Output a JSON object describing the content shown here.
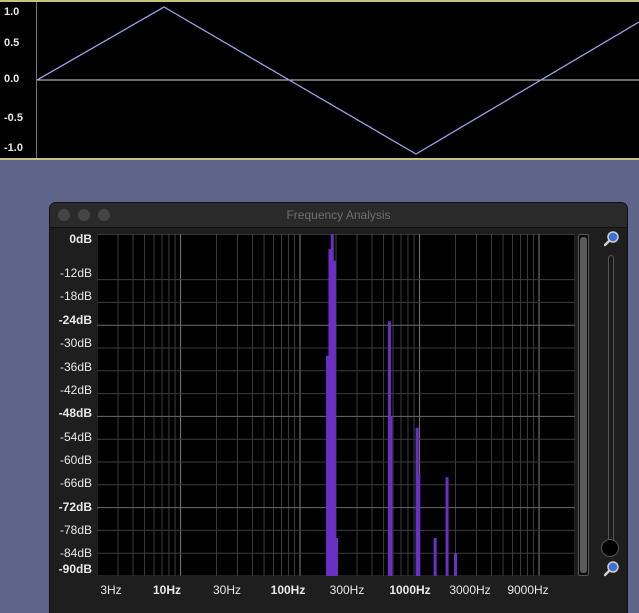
{
  "waveform": {
    "ruler_labels": [
      "1.0",
      "0.5",
      "0.0",
      "-0.5",
      "-1.0"
    ],
    "colors": {
      "line": "#9aa0e6",
      "zero_line": "#d8d8d8"
    }
  },
  "analysis_window": {
    "title": "Frequency Analysis",
    "db_labels": [
      "0dB",
      "-12dB",
      "-18dB",
      "-24dB",
      "-30dB",
      "-36dB",
      "-42dB",
      "-48dB",
      "-54dB",
      "-60dB",
      "-66dB",
      "-72dB",
      "-78dB",
      "-84dB",
      "-90dB"
    ],
    "hz_labels": [
      "3Hz",
      "10Hz",
      "30Hz",
      "100Hz",
      "300Hz",
      "1000Hz",
      "3000Hz",
      "9000Hz"
    ],
    "colors": {
      "spectrum": "#6a2fc4",
      "grid": "#3c3c3c",
      "grid_major": "#6a6a6a"
    },
    "icons": [
      "zoom-in-icon",
      "zoom-out-icon"
    ]
  },
  "chart_data": {
    "type": "bar",
    "x_scale": "log",
    "xlim_hz": [
      2,
      20000
    ],
    "ylim_db": [
      -90,
      0
    ],
    "ylabel_ticks": [
      0,
      -12,
      -18,
      -24,
      -30,
      -36,
      -42,
      -48,
      -54,
      -60,
      -66,
      -72,
      -78,
      -84,
      -90
    ],
    "xtick_labels_hz": [
      3,
      10,
      30,
      100,
      300,
      1000,
      3000,
      9000
    ],
    "peaks": [
      {
        "hz": 170,
        "db": -32
      },
      {
        "hz": 178,
        "db": -4
      },
      {
        "hz": 186,
        "db": 0
      },
      {
        "hz": 194,
        "db": -7
      },
      {
        "hz": 202,
        "db": -80
      },
      {
        "hz": 560,
        "db": -23
      },
      {
        "hz": 575,
        "db": -48
      },
      {
        "hz": 955,
        "db": -51
      },
      {
        "hz": 985,
        "db": -63
      },
      {
        "hz": 1350,
        "db": -80
      },
      {
        "hz": 1700,
        "db": -64
      },
      {
        "hz": 2000,
        "db": -84
      }
    ]
  }
}
